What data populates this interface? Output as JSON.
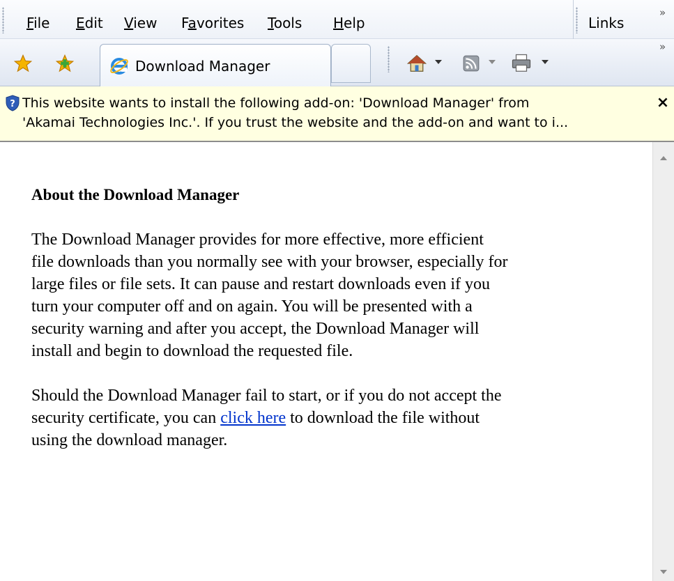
{
  "menubar": {
    "items": [
      {
        "label": "File",
        "accel": "F",
        "rest": "ile"
      },
      {
        "label": "Edit",
        "accel": "E",
        "rest": "dit"
      },
      {
        "label": "View",
        "accel": "V",
        "rest": "iew"
      },
      {
        "label": "Favorites",
        "pre": "F",
        "accel": "a",
        "rest": "vorites"
      },
      {
        "label": "Tools",
        "accel": "T",
        "rest": "ools"
      },
      {
        "label": "Help",
        "accel": "H",
        "rest": "elp"
      }
    ],
    "links_label": "Links",
    "overflow_glyph": "»"
  },
  "toolbar": {
    "tab_title": "Download Manager",
    "overflow_glyph": "»",
    "icons": [
      "favorites-star-icon",
      "add-favorites-icon",
      "home-icon",
      "rss-feed-icon",
      "print-icon"
    ]
  },
  "infobar": {
    "line1": "This website wants to install the following add-on: 'Download Manager' from",
    "line2": "'Akamai Technologies Inc.'. If you trust the website and the add-on and want to i...",
    "close_glyph": "×"
  },
  "content": {
    "heading": "About the Download Manager",
    "para1_lines": [
      "The Download Manager provides for more effective, more efficient",
      "file downloads than you normally see with your browser, especially for",
      "large files or file sets. It can pause and restart downloads even if you",
      "turn your computer off and on again. You will be presented with a",
      "security warning and after you accept, the Download Manager will",
      "install and begin to download the requested file."
    ],
    "para2_line1": "Should the Download Manager fail to start, or if you do not accept the",
    "para2_line2_before": "security certificate, you can ",
    "link_text": "click here",
    "para2_line2_after": " to download the file without",
    "para2_line3": "using the download manager."
  },
  "colors": {
    "infobar_bg": "#ffffe1",
    "link": "#0033cc",
    "star": "#f5b400"
  }
}
